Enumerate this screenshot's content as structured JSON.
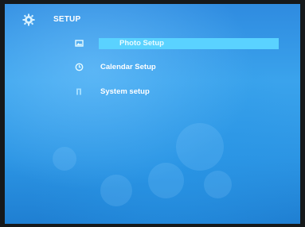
{
  "header": {
    "title": "SETUP",
    "icon": "gear-icon"
  },
  "menu": {
    "selected_index": 0,
    "items": [
      {
        "label": "Photo Setup",
        "icon": "photo-icon"
      },
      {
        "label": "Calendar Setup",
        "icon": "clock-icon"
      },
      {
        "label": "System setup",
        "icon": "system-icon"
      }
    ]
  },
  "colors": {
    "background": "#2f8be0",
    "highlight": "#5ad2ff",
    "text": "#ffffff"
  }
}
